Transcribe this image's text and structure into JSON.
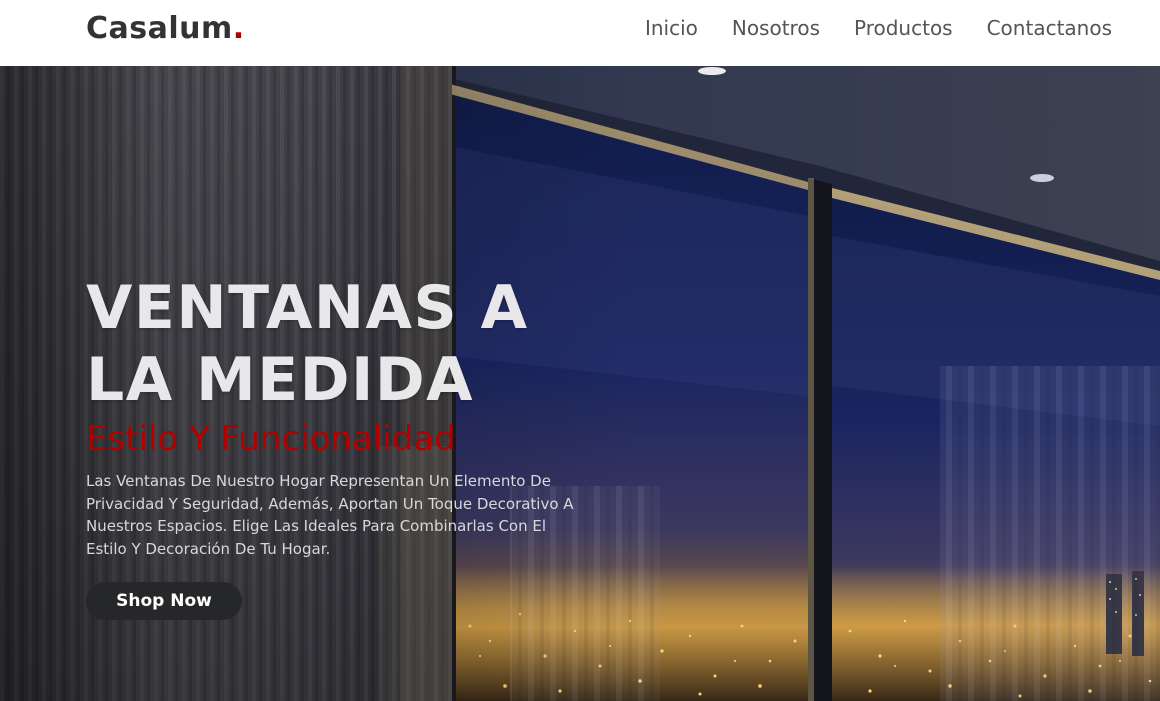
{
  "brand": {
    "name": "Casalum",
    "dot": ".",
    "accent_color": "#b00000"
  },
  "nav": {
    "items": [
      {
        "label": "Inicio"
      },
      {
        "label": "Nosotros"
      },
      {
        "label": "Productos"
      },
      {
        "label": "Contactanos"
      }
    ]
  },
  "hero": {
    "title_line1": "VENTANAS A",
    "title_line2": "LA MEDIDA",
    "subtitle": "Estilo Y Funcionalidad",
    "description": "Las Ventanas De Nuestro Hogar Representan Un Elemento De Privacidad Y Seguridad, Además, Aportan Un Toque Decorativo A Nuestros Espacios. Elige Las Ideales Para Combinarlas Con El Estilo Y Decoración De Tu Hogar.",
    "cta_label": "Shop Now",
    "background_image": "interior room with sheer curtains and floor-to-ceiling windows overlooking a city at night"
  }
}
